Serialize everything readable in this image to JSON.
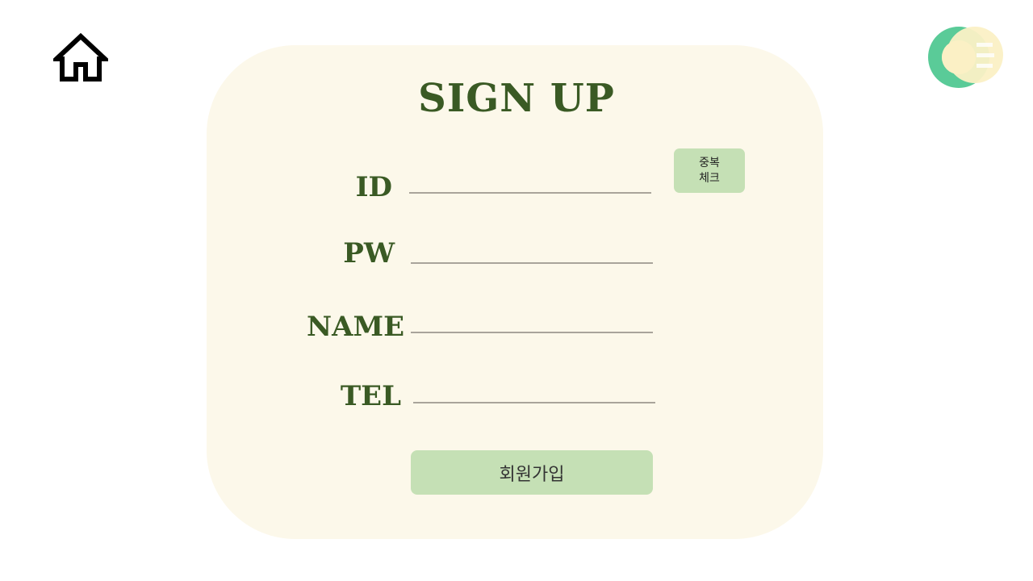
{
  "header": {
    "home_icon": "home-icon",
    "logo_icon": "app-logo"
  },
  "form": {
    "title": "SIGN UP",
    "fields": [
      {
        "label": "ID",
        "value": "",
        "placeholder": ""
      },
      {
        "label": "PW",
        "value": "",
        "placeholder": ""
      },
      {
        "label": "NAME",
        "value": "",
        "placeholder": ""
      },
      {
        "label": "TEL",
        "value": "",
        "placeholder": ""
      }
    ],
    "dup_check": {
      "line1": "중복",
      "line2": "체크"
    },
    "submit_label": "회원가입"
  },
  "colors": {
    "card_background": "#fcf8ea",
    "title_color": "#3a5a24",
    "button_background": "#c5e0b5",
    "underline": "#a9a49b",
    "logo_green": "#5acb98",
    "logo_cream": "#fbf0c5"
  }
}
